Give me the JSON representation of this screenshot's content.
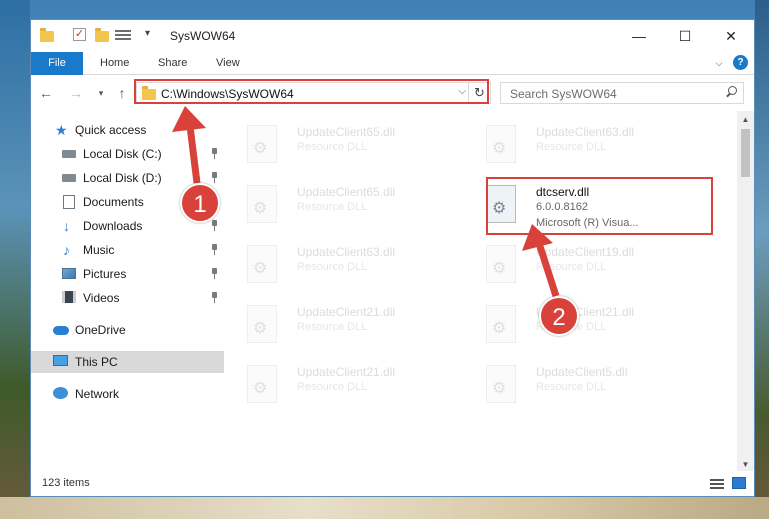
{
  "window": {
    "title": "SysWOW64",
    "controls": {
      "minimize": "—",
      "maximize": "☐",
      "close": "✕"
    }
  },
  "ribbon": {
    "file": "File",
    "tabs": [
      "Home",
      "Share",
      "View"
    ],
    "help": "?"
  },
  "address": {
    "path": "C:\\Windows\\SysWOW64"
  },
  "search": {
    "placeholder": "Search SysWOW64"
  },
  "sidebar": {
    "quick_access": "Quick access",
    "items": [
      {
        "label": "Local Disk (C:)",
        "icon": "drive-icon",
        "pinned": true
      },
      {
        "label": "Local Disk (D:)",
        "icon": "drive-icon",
        "pinned": true
      },
      {
        "label": "Documents",
        "icon": "documents-icon",
        "pinned": true
      },
      {
        "label": "Downloads",
        "icon": "downloads-icon",
        "pinned": true
      },
      {
        "label": "Music",
        "icon": "music-icon",
        "pinned": true
      },
      {
        "label": "Pictures",
        "icon": "pictures-icon",
        "pinned": true
      },
      {
        "label": "Videos",
        "icon": "videos-icon",
        "pinned": true
      }
    ],
    "onedrive": "OneDrive",
    "this_pc": "This PC",
    "network": "Network"
  },
  "files": {
    "left": [
      {
        "name": "UpdateClient65.dll",
        "desc": "Resource DLL"
      },
      {
        "name": "UpdateClient65.dll",
        "desc": "Resource DLL"
      },
      {
        "name": "UpdateClient63.dll",
        "desc": "Resource DLL"
      },
      {
        "name": "UpdateClient21.dll",
        "desc": "Resource DLL"
      },
      {
        "name": "UpdateClient21.dll",
        "desc": "Resource DLL"
      }
    ],
    "right": [
      {
        "name": "UpdateClient63.dll",
        "desc": "Resource DLL"
      },
      {
        "name": "UpdateClient19.dll",
        "desc": "Resource DLL"
      },
      {
        "name": "UpdateClient21.dll",
        "desc": "Resource DLL"
      },
      {
        "name": "UpdateClient5.dll",
        "desc": "Resource DLL"
      }
    ],
    "focus": {
      "name": "dtcserv.dll",
      "version": "6.0.0.8162",
      "company": "Microsoft (R) Visua..."
    }
  },
  "status": {
    "count": "123 items"
  },
  "annotations": {
    "badge1": "1",
    "badge2": "2",
    "color": "#d9423a"
  },
  "colors": {
    "accent": "#1979ca",
    "selected": "#d9d9d9"
  }
}
